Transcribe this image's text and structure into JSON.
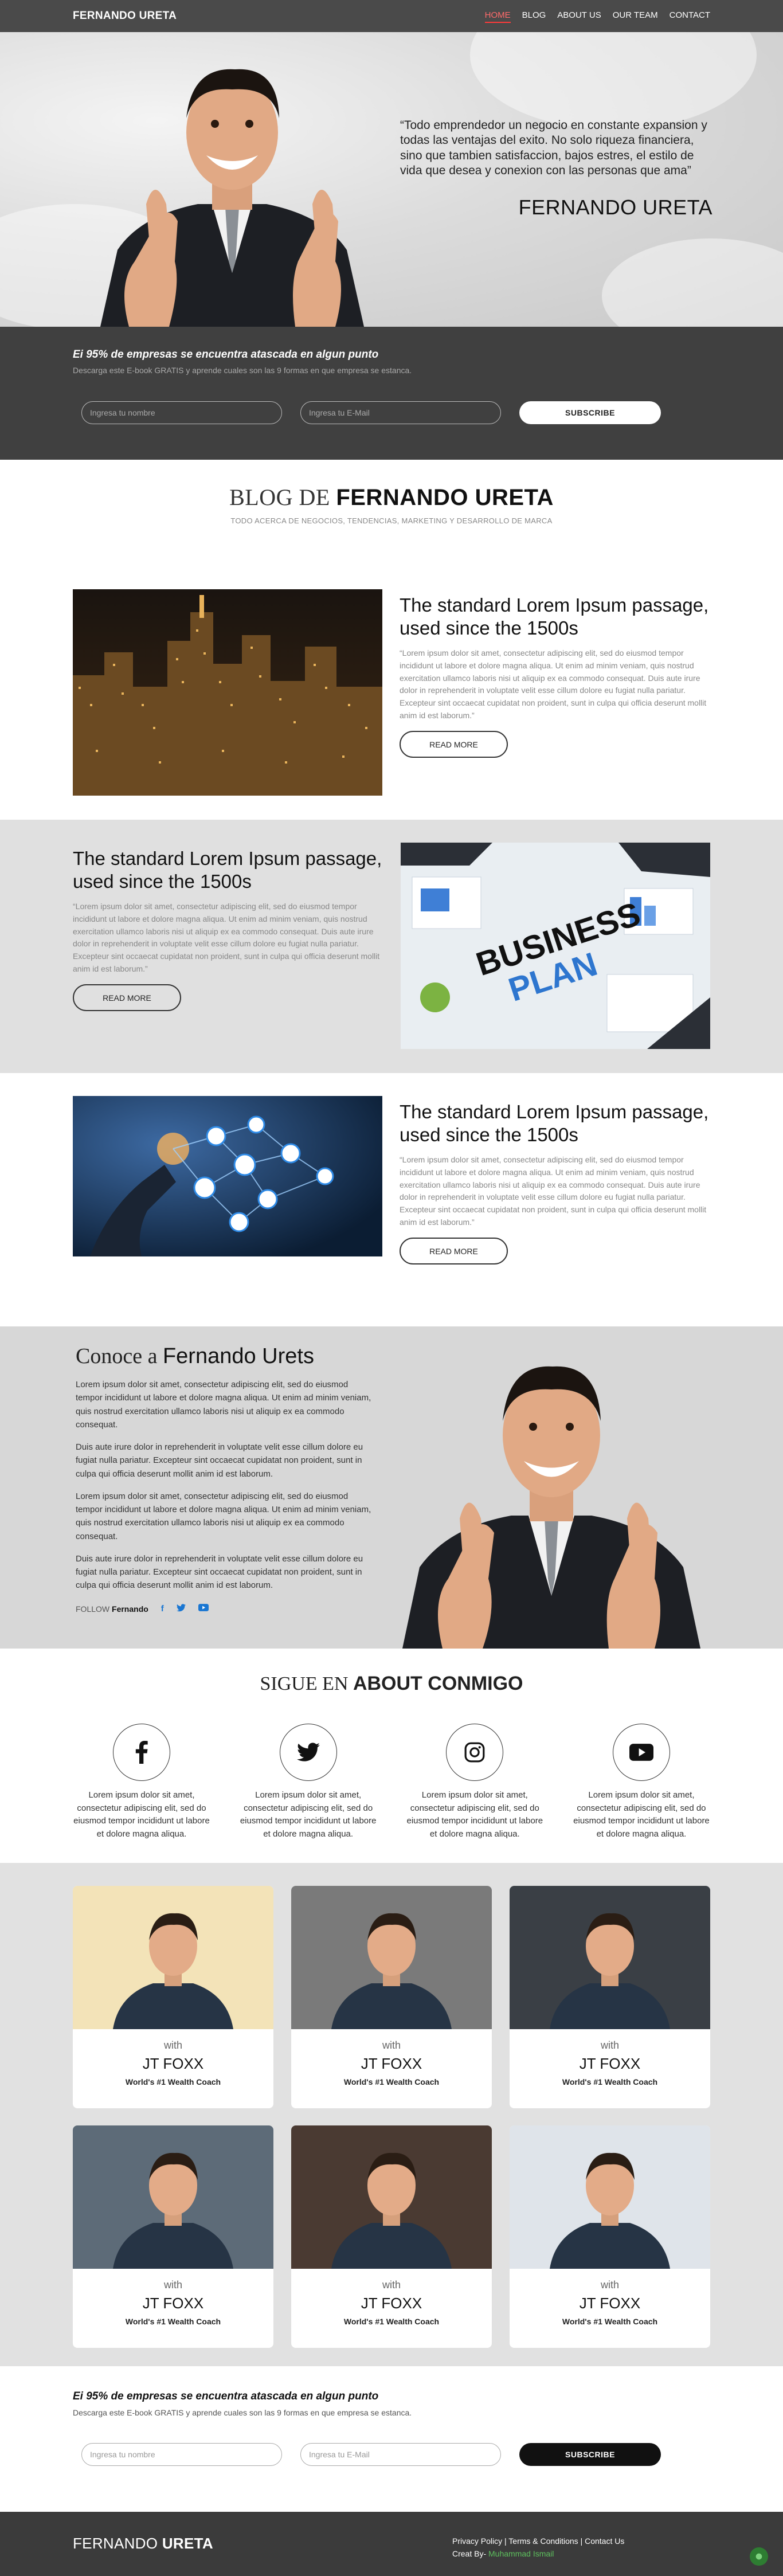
{
  "nav": {
    "brand": "FERNANDO URETA",
    "items": [
      {
        "label": "HOME",
        "active": true
      },
      {
        "label": "BLOG"
      },
      {
        "label": "ABOUT US"
      },
      {
        "label": "OUR TEAM"
      },
      {
        "label": "CONTACT"
      }
    ]
  },
  "hero": {
    "quote": "“Todo emprendedor un negocio en constante expansion y todas las ventajas del exito. No solo riqueza financiera, sino que tambien satisfaccion, bajos estres, el estilo de vida que desea y conexion con las personas que ama”",
    "name": "FERNANDO URETA"
  },
  "subscribe_top": {
    "heading": "Ei 95% de empresas se encuentra atascada en algun punto",
    "text": "Descarga este E-book GRATIS y aprende cuales son las 9 formas en que empresa se estanca.",
    "name_placeholder": "Ingresa tu nombre",
    "email_placeholder": "Ingresa tu E-Mail",
    "button": "SUBSCRIBE"
  },
  "blog": {
    "title_prefix": "BLOG DE",
    "title_name": "FERNANDO URETA",
    "subtitle": "TODO ACERCA DE NEGOCIOS, TENDENCIAS, MARKETING Y DESARROLLO DE MARCA",
    "posts": [
      {
        "title": "The standard Lorem Ipsum passage, used since the 1500s",
        "body": "“Lorem ipsum dolor sit amet, consectetur adipiscing elit, sed do eiusmod tempor incididunt ut labore et dolore magna aliqua. Ut enim ad minim veniam, quis nostrud exercitation ullamco laboris nisi ut aliquip ex ea commodo consequat. Duis aute irure dolor in reprehenderit in voluptate velit esse cillum dolore eu fugiat nulla pariatur. Excepteur sint occaecat cupidatat non proident, sunt in culpa qui officia deserunt mollit anim id est laborum.”",
        "button": "READ MORE",
        "image": "city-night"
      },
      {
        "title": "The standard Lorem Ipsum passage, used since the 1500s",
        "body": "“Lorem ipsum dolor sit amet, consectetur adipiscing elit, sed do eiusmod tempor incididunt ut labore et dolore magna aliqua. Ut enim ad minim veniam, quis nostrud exercitation ullamco laboris nisi ut aliquip ex ea commodo consequat. Duis aute irure dolor in reprehenderit in voluptate velit esse cillum dolore eu fugiat nulla pariatur. Excepteur sint occaecat cupidatat non proident, sunt in culpa qui officia deserunt mollit anim id est laborum.”",
        "button": "READ MORE",
        "image": "business-plan",
        "image_text_1": "BUSINESS",
        "image_text_2": "PLAN"
      },
      {
        "title": "The standard Lorem Ipsum passage, used since the 1500s",
        "body": "“Lorem ipsum dolor sit amet, consectetur adipiscing elit, sed do eiusmod tempor incididunt ut labore et dolore magna aliqua. Ut enim ad minim veniam, quis nostrud exercitation ullamco laboris nisi ut aliquip ex ea commodo consequat. Duis aute irure dolor in reprehenderit in voluptate velit esse cillum dolore eu fugiat nulla pariatur. Excepteur sint occaecat cupidatat non proident, sunt in culpa qui officia deserunt mollit anim id est laborum.”",
        "button": "READ MORE",
        "image": "network"
      }
    ]
  },
  "about": {
    "title_prefix": "Conoce a",
    "title_name": "Fernando Urets",
    "paragraphs": [
      "Lorem ipsum dolor sit amet, consectetur adipiscing elit, sed do eiusmod tempor incididunt ut labore et dolore magna aliqua. Ut enim ad minim veniam, quis nostrud exercitation ullamco laboris nisi ut aliquip ex ea commodo consequat.",
      "Duis aute irure dolor in reprehenderit in voluptate velit esse cillum dolore eu fugiat nulla pariatur. Excepteur sint occaecat cupidatat non proident, sunt in culpa qui officia deserunt mollit anim id est laborum.",
      "Lorem ipsum dolor sit amet, consectetur adipiscing elit, sed do eiusmod tempor incididunt ut labore et dolore magna aliqua. Ut enim ad minim veniam, quis nostrud exercitation ullamco laboris nisi ut aliquip ex ea commodo consequat.",
      "Duis aute irure dolor in reprehenderit in voluptate velit esse cillum dolore eu fugiat nulla pariatur. Excepteur sint occaecat cupidatat non proident, sunt in culpa qui officia deserunt mollit anim id est laborum."
    ],
    "follow_label": "FOLLOW",
    "follow_name": "Fernando"
  },
  "social": {
    "title_prefix": "SIGUE EN",
    "title_bold": "ABOUT CONMIGO",
    "items": [
      {
        "icon": "facebook-icon",
        "text": "Lorem ipsum dolor sit amet, consectetur adipiscing elit, sed do eiusmod tempor incididunt ut labore et dolore magna aliqua."
      },
      {
        "icon": "twitter-icon",
        "text": "Lorem ipsum dolor sit amet, consectetur adipiscing elit, sed do eiusmod tempor incididunt ut labore et dolore magna aliqua."
      },
      {
        "icon": "instagram-icon",
        "text": "Lorem ipsum dolor sit amet, consectetur adipiscing elit, sed do eiusmod tempor incididunt ut labore et dolore magna aliqua."
      },
      {
        "icon": "youtube-icon",
        "text": "Lorem ipsum dolor sit amet, consectetur adipiscing elit, sed do eiusmod tempor incididunt ut labore et dolore magna aliqua."
      }
    ]
  },
  "coaches": [
    {
      "with": "with",
      "name": "JT FOXX",
      "title": "World's #1 Wealth Coach",
      "bg": "#f3e3b8"
    },
    {
      "with": "with",
      "name": "JT FOXX",
      "title": "World's #1 Wealth Coach",
      "bg": "#7a7a7a"
    },
    {
      "with": "with",
      "name": "JT FOXX",
      "title": "World's #1 Wealth Coach",
      "bg": "#3a3f45"
    },
    {
      "with": "with",
      "name": "JT FOXX",
      "title": "World's #1 Wealth Coach",
      "bg": "#5d6b78"
    },
    {
      "with": "with",
      "name": "JT FOXX",
      "title": "World's #1 Wealth Coach",
      "bg": "#4a3a32"
    },
    {
      "with": "with",
      "name": "JT FOXX",
      "title": "World's #1 Wealth Coach",
      "bg": "#dfe4ea"
    }
  ],
  "subscribe_bottom": {
    "heading": "Ei 95% de empresas se encuentra atascada en algun punto",
    "text": "Descarga este E-book GRATIS y aprende cuales son las 9 formas en que empresa se estanca.",
    "name_placeholder": "Ingresa tu nombre",
    "email_placeholder": "Ingresa tu E-Mail",
    "button": "SUBSCRIBE"
  },
  "footer": {
    "brand_prefix": "FERNANDO",
    "brand_bold": "URETA",
    "links": "Privacy Policy | Terms & Conditions | Contact Us",
    "credit_label": "Creat By-",
    "credit_name": "Muhammad Ismail"
  },
  "colors": {
    "accent": "#ff3b3b",
    "dark": "#404040",
    "facebook": "#1976d2",
    "green": "#5ec15e"
  }
}
